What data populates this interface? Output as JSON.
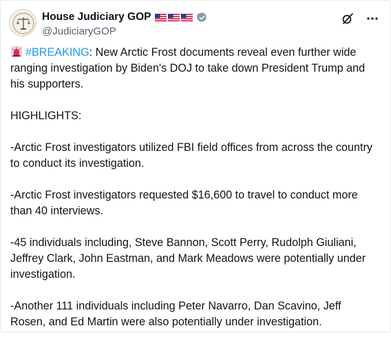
{
  "author": {
    "display_name": "House Judiciary GOP",
    "handle": "@JudiciaryGOP",
    "flags": [
      "us-flag-icon",
      "us-flag-icon",
      "us-flag-icon"
    ],
    "verified_icon": "verified-badge-icon",
    "avatar_icon": "scales-of-justice-icon"
  },
  "actions": {
    "grok_icon": "grok-icon",
    "more_icon": "more-options-icon"
  },
  "tweet": {
    "intro": {
      "emoji_icon": "police-siren-icon",
      "hashtag": "#BREAKING",
      "text": ": New Arctic Frost documents reveal even further wide ranging investigation by Biden's DOJ to take down President Trump and his supporters."
    },
    "highlights_label": "HIGHLIGHTS:",
    "points": [
      "-Arctic Frost investigators utilized FBI field offices from across the country to conduct its investigation.",
      "-Arctic Frost investigators requested $16,600 to travel to conduct more than 40 interviews.",
      "-45 individuals including, Steve Bannon, Scott Perry, Rudolph Giuliani, Jeffrey Clark, John Eastman, and Mark Meadows were potentially under investigation.",
      "-Another 111 individuals including Peter Navarro, Dan Scavino, Jeff Rosen, and Ed Martin were also potentially under investigation."
    ]
  },
  "colors": {
    "text": "#0f1419",
    "secondary": "#536471",
    "link": "#1d9bf0",
    "verified": "#829aab"
  }
}
